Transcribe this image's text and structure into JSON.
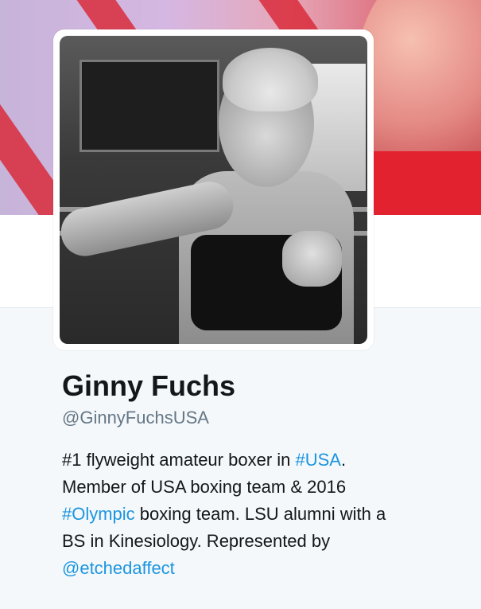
{
  "profile": {
    "name": "Ginny Fuchs",
    "handle": "@GinnyFuchsUSA",
    "bio": {
      "line1_text": "#1 flyweight amateur boxer in ",
      "line1_hashtag": "#USA",
      "line1_end": ".",
      "line2_text": "Member of USA boxing team & 2016",
      "line3_hashtag": "#Olympic",
      "line3_text": " boxing team. LSU alumni with a",
      "line4_text": "BS in Kinesiology. Represented by",
      "line5_mention": "@etchedaffect"
    }
  },
  "colors": {
    "link": "#1b95e0",
    "name_text": "#14171a",
    "handle_text": "#657786",
    "background": "#f5f8fa"
  }
}
